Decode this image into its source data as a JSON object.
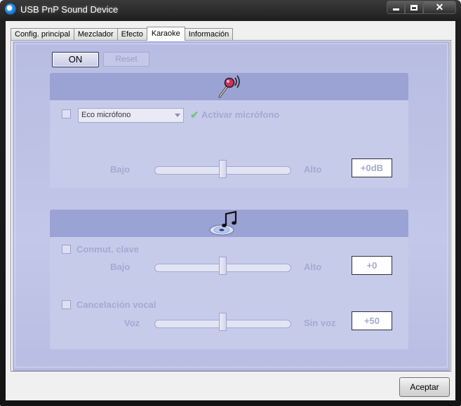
{
  "window": {
    "title": "USB PnP Sound Device"
  },
  "tabs": [
    {
      "label": "Config. principal"
    },
    {
      "label": "Mezclador"
    },
    {
      "label": "Efecto"
    },
    {
      "label": "Karaoke"
    },
    {
      "label": "Información"
    }
  ],
  "active_tab": "Karaoke",
  "toolbar": {
    "on_label": "ON",
    "reset_label": "Reset"
  },
  "microphone_group": {
    "icon": "microphone-icon",
    "echo_select_value": "Eco micrófono",
    "activate_label": "Activar micrófono",
    "slider": {
      "low_label": "Bajo",
      "high_label": "Alto",
      "value_text": "+0dB",
      "level": 0.5
    }
  },
  "music_group": {
    "icon": "music-disc-icon",
    "key_shift": {
      "label": "Conmut. clave",
      "low_label": "Bajo",
      "high_label": "Alto",
      "value_text": "+0",
      "level": 0.5
    },
    "vocal_cancel": {
      "label": "Cancelación vocal",
      "low_label": "Voz",
      "high_label": "Sin voz",
      "value_text": "+50",
      "level": 0.5
    }
  },
  "footer": {
    "accept_label": "Aceptar"
  },
  "colors": {
    "panel": "#c3c7e8",
    "group_header": "#9ba2d4",
    "disabled_text": "#a5a9d2"
  }
}
